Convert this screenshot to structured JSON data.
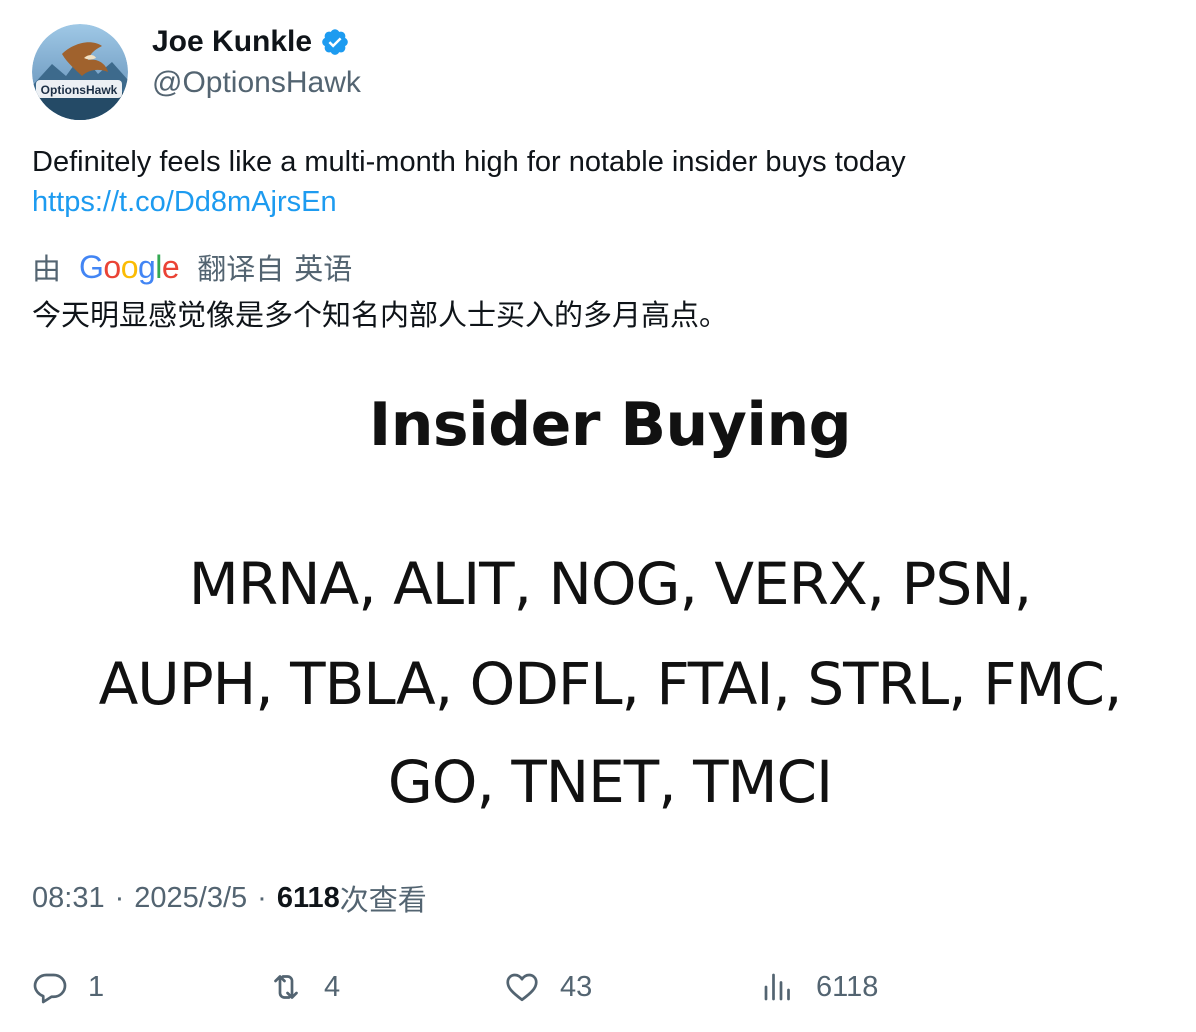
{
  "author": {
    "display_name": "Joe Kunkle",
    "handle": "@OptionsHawk",
    "verified": true,
    "avatar_logo_text": "OptionsHawk"
  },
  "tweet": {
    "text": "Definitely feels like a multi-month high for notable insider buys today",
    "link": "https://t.co/Dd8mAjrsEn"
  },
  "translation": {
    "by_label": "由",
    "provider": "Google",
    "from_label": "翻译自",
    "language": "英语",
    "text": "今天明显感觉像是多个知名内部人士买入的多月高点。"
  },
  "media": {
    "title": "Insider Buying",
    "line1": "MRNA, ALIT, NOG, VERX, PSN,",
    "line2": "AUPH, TBLA, ODFL, FTAI, STRL, FMC,",
    "line3": "GO, TNET, TMCI"
  },
  "meta": {
    "time": "08:31",
    "date": "2025/3/5",
    "views": "6118",
    "views_label": "次查看",
    "separator": "·"
  },
  "actions": {
    "replies": "1",
    "retweets": "4",
    "likes": "43",
    "views": "6118"
  },
  "colors": {
    "accent": "#1d9bf0",
    "muted": "#536471",
    "text": "#0f1419"
  }
}
